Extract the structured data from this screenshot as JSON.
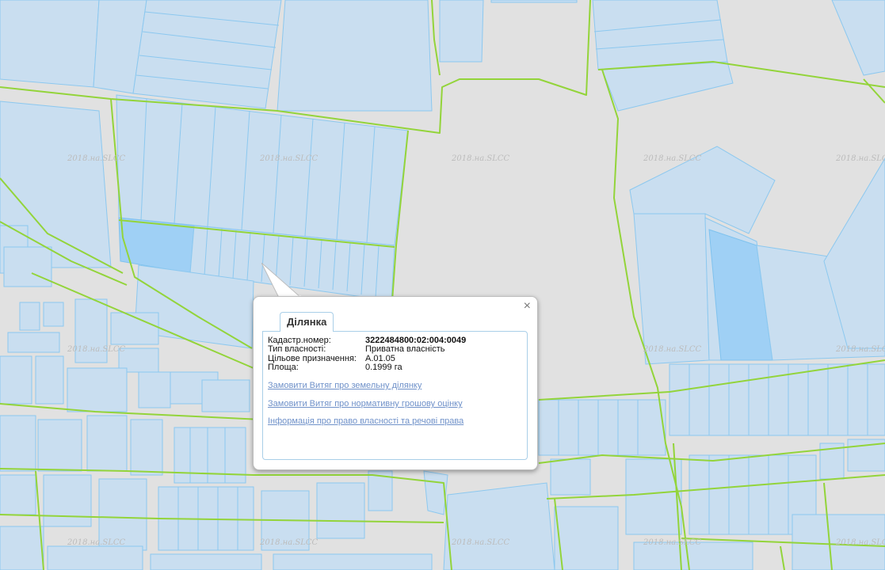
{
  "map": {
    "watermark": "2018.на.SLCC"
  },
  "popup": {
    "close_glyph": "×",
    "tab_label": "Ділянка",
    "fields": [
      {
        "label": "Кадастр.номер:",
        "value": "3222484800:02:004:0049"
      },
      {
        "label": "Тип власності:",
        "value": "Приватна власність"
      },
      {
        "label": "Цільове призначення:",
        "value": "A.01.05"
      },
      {
        "label": "Площа:",
        "value": "0.1999 га"
      }
    ],
    "links": [
      "Замовити Витяг про земельну ділянку",
      "Замовити Витяг про нормативну грошову оцінку",
      "Інформація про право власності та речові права"
    ]
  },
  "colors": {
    "background": "#e1e1e1",
    "parcel_fill": "#c9def0",
    "parcel_stroke": "#8cc8ef",
    "selected_parcel": "#9fd0f5",
    "road_line": "#93d43a",
    "link": "#6f91c9"
  }
}
